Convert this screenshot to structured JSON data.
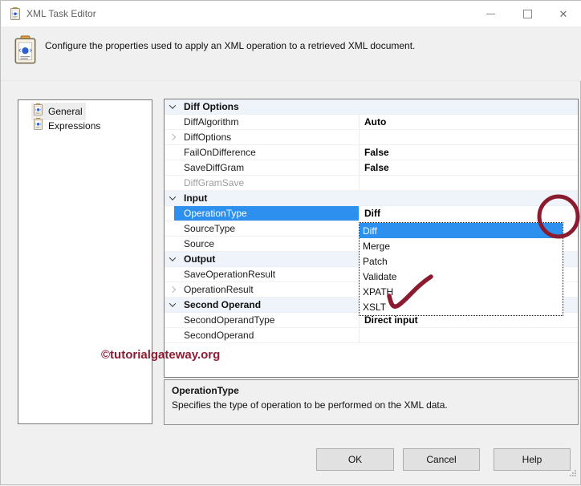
{
  "window": {
    "title": "XML Task Editor"
  },
  "header": {
    "description": "Configure the properties used to apply an XML operation to a retrieved XML document."
  },
  "sidebar": {
    "items": [
      {
        "label": "General",
        "selected": true
      },
      {
        "label": "Expressions",
        "selected": false
      }
    ]
  },
  "property_grid": {
    "rows": [
      {
        "type": "category",
        "label": "Diff Options",
        "value": ""
      },
      {
        "type": "item",
        "label": "DiffAlgorithm",
        "value": "Auto"
      },
      {
        "type": "item",
        "label": "DiffOptions",
        "value": "",
        "expandable": true
      },
      {
        "type": "item",
        "label": "FailOnDifference",
        "value": "False"
      },
      {
        "type": "item",
        "label": "SaveDiffGram",
        "value": "False"
      },
      {
        "type": "item",
        "label": "DiffGramSave",
        "value": "",
        "disabled": true
      },
      {
        "type": "category",
        "label": "Input",
        "value": ""
      },
      {
        "type": "item",
        "label": "OperationType",
        "value": "Diff",
        "selected": true,
        "has_dropdown": true
      },
      {
        "type": "item",
        "label": "SourceType",
        "value": ""
      },
      {
        "type": "item",
        "label": "Source",
        "value": ""
      },
      {
        "type": "category",
        "label": "Output",
        "value": ""
      },
      {
        "type": "item",
        "label": "SaveOperationResult",
        "value": ""
      },
      {
        "type": "item",
        "label": "OperationResult",
        "value": "",
        "expandable": true
      },
      {
        "type": "category",
        "label": "Second Operand",
        "value": ""
      },
      {
        "type": "item",
        "label": "SecondOperandType",
        "value": "Direct input"
      },
      {
        "type": "item",
        "label": "SecondOperand",
        "value": ""
      }
    ]
  },
  "dropdown": {
    "options": [
      {
        "label": "Diff",
        "selected": true
      },
      {
        "label": "Merge",
        "selected": false
      },
      {
        "label": "Patch",
        "selected": false
      },
      {
        "label": "Validate",
        "selected": false
      },
      {
        "label": "XPATH",
        "selected": false
      },
      {
        "label": "XSLT",
        "selected": false
      }
    ]
  },
  "help_panel": {
    "title": "OperationType",
    "description": "Specifies the type of operation to be performed on the XML data."
  },
  "buttons": [
    {
      "label": "OK"
    },
    {
      "label": "Cancel"
    },
    {
      "label": "Help"
    }
  ],
  "watermark": "©tutorialgateway.org",
  "colors": {
    "selection_blue": "#2d90ef",
    "annotation_maroon": "#8b1c30",
    "watermark_red": "#8e1c33",
    "category_bg": "#eff4fa"
  }
}
